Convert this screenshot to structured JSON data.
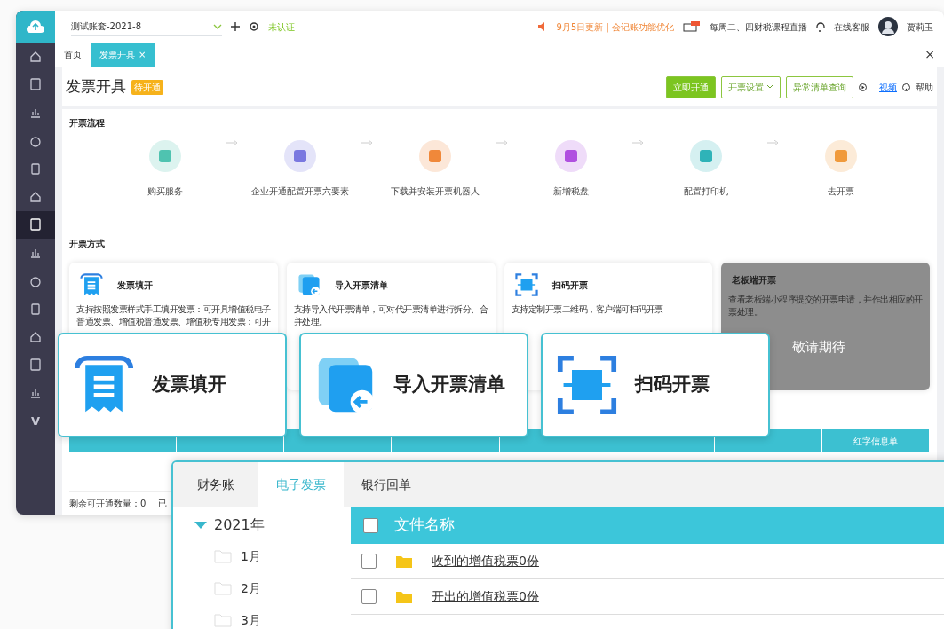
{
  "topbar": {
    "account": "测试账套-2021-8",
    "cert_status": "未认证",
    "notice": "9月5日更新 | 会记账功能优化",
    "live": "每周二、四财税课程直播",
    "service": "在线客服",
    "user": "贾莉玉"
  },
  "sidebar": {
    "items": [
      {
        "selected": false
      },
      {
        "selected": false
      },
      {
        "selected": false
      },
      {
        "selected": false
      },
      {
        "selected": false
      },
      {
        "selected": false
      },
      {
        "selected": true
      },
      {
        "selected": false
      },
      {
        "selected": false
      },
      {
        "selected": false
      },
      {
        "selected": false
      },
      {
        "selected": false
      },
      {
        "selected": false
      },
      {
        "selected": false,
        "glyph": "V"
      }
    ]
  },
  "tabs": [
    {
      "label": "首页",
      "selected": false
    },
    {
      "label": "发票开具",
      "selected": true,
      "close": "×"
    }
  ],
  "close_all": "×",
  "page": {
    "title": "发票开具",
    "badge": "待开通",
    "actions": [
      {
        "label": "立即开通",
        "kind": "primary"
      },
      {
        "label": "开票设置",
        "kind": "dropdown"
      },
      {
        "label": "异常清单查询",
        "kind": "outline"
      }
    ],
    "video": "视频",
    "help": "帮助"
  },
  "process": {
    "title": "开票流程",
    "steps": [
      {
        "label": "购买服务",
        "color": "#4fc3b0"
      },
      {
        "label": "企业开通配置开票六要素",
        "color": "#7a78e0"
      },
      {
        "label": "下载并安装开票机器人",
        "color": "#f0883a"
      },
      {
        "label": "新增税盘",
        "color": "#b050e0"
      },
      {
        "label": "配置打印机",
        "color": "#2fb3b8"
      },
      {
        "label": "去开票",
        "color": "#f09a3c"
      }
    ]
  },
  "methods": {
    "title": "开票方式",
    "cards": [
      {
        "kind": "fill",
        "title": "发票填开",
        "desc": "支持按照发票样式手工填开发票：可开具增值税电子普通发票、增值税普通发票、增值税专用发票：可开",
        "disabled": false
      },
      {
        "kind": "import",
        "title": "导入开票清单",
        "desc": "支持导入代开票清单，可对代开票清单进行拆分、合并处理。",
        "disabled": false
      },
      {
        "kind": "scan",
        "title": "扫码开票",
        "desc": "支持定制开票二维码，客户端可扫码开票",
        "disabled": false
      },
      {
        "kind": "boss",
        "title": "老板端开票",
        "desc": "查看老板端小程序提交的开票申请，并作出相应的开票处理。",
        "disabled": true,
        "overlay": "敬请期待"
      }
    ]
  },
  "table": {
    "last_column": "红字信息单",
    "cell": "--",
    "remaining": "剩余可开通数量：0",
    "opened": "已"
  },
  "callouts": [
    {
      "kind": "fill",
      "label": "发票填开"
    },
    {
      "kind": "import",
      "label": "导入开票清单"
    },
    {
      "kind": "scan",
      "label": "扫码开票"
    }
  ],
  "archive": {
    "tabs": [
      {
        "label": "财务账",
        "selected": false
      },
      {
        "label": "电子发票",
        "selected": true
      },
      {
        "label": "银行回单",
        "selected": false
      }
    ],
    "tree": [
      {
        "label": "2021年",
        "expanded": true,
        "children": [
          {
            "label": "1月"
          },
          {
            "label": "2月"
          },
          {
            "label": "3月"
          }
        ]
      }
    ],
    "header": {
      "label": "文件名称",
      "checked": false
    },
    "rows": [
      {
        "name": "收到的增值税票0份",
        "checked": false
      },
      {
        "name": "开出的增值税票0份",
        "checked": false
      }
    ]
  }
}
